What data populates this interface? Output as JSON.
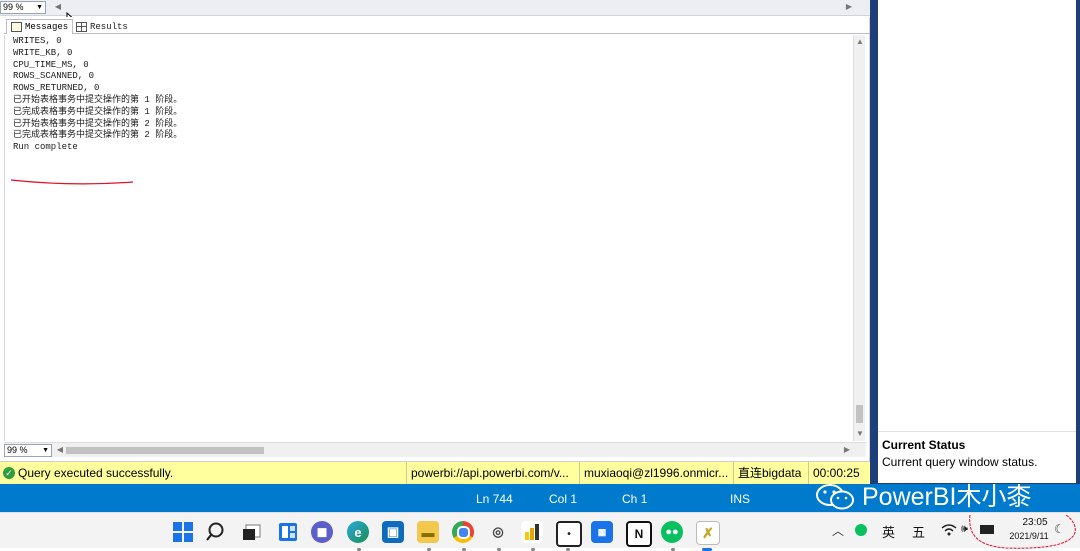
{
  "top_zoom": "99 %",
  "tabs": {
    "messages": "Messages",
    "results": "Results"
  },
  "messages": [
    "WRITES, 0",
    "WRITE_KB, 0",
    "CPU_TIME_MS, 0",
    "ROWS_SCANNED, 0",
    "ROWS_RETURNED, 0",
    "",
    "",
    "已开始表格事务中提交操作的第 1 阶段。",
    "已完成表格事务中提交操作的第 1 阶段。",
    "已开始表格事务中提交操作的第 2 阶段。",
    "已完成表格事务中提交操作的第 2 阶段。",
    "Run complete"
  ],
  "bottom_zoom": "99 %",
  "status": {
    "message": "Query executed successfully.",
    "server": "powerbi://api.powerbi.com/v...",
    "user": "muxiaoqi@zl1996.onmicr...",
    "database": "直连bigdata",
    "elapsed": "00:00:25"
  },
  "editor_status": {
    "ln": "Ln 744",
    "col": "Col 1",
    "ch": "Ch 1",
    "mode": "INS"
  },
  "properties": {
    "title": "Current Status",
    "description": "Current query window status."
  },
  "watermark": "PowerBI木小桼",
  "tray": {
    "ime_lang": "英",
    "ime_mode": "五",
    "time": "23:05",
    "date": "2021/9/11"
  },
  "colors": {
    "status_bg": "#ffff9e",
    "accent_blue": "#007acc",
    "annotation_red": "#e0102a",
    "success_green": "#2e9e3e"
  }
}
